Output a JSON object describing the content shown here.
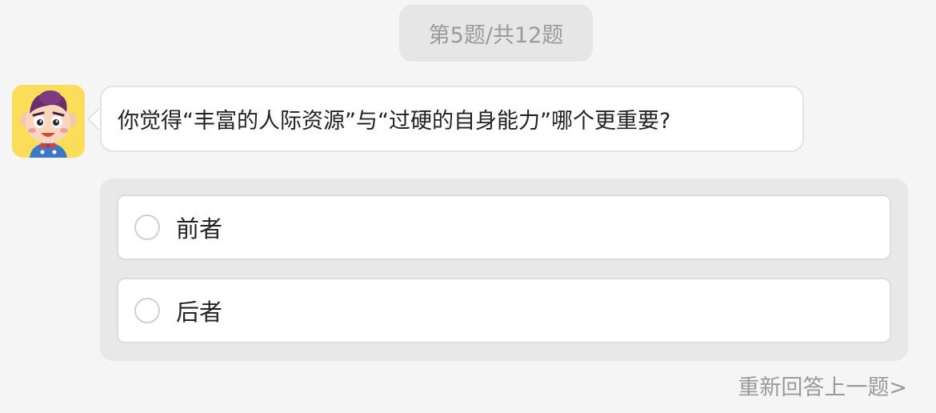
{
  "progress": {
    "text": "第5题/共12题"
  },
  "question": {
    "avatar_icon": "cartoon-boy-avatar",
    "text": "你觉得“丰富的人际资源”与“过硬的自身能力”哪个更重要?"
  },
  "options": [
    {
      "label": "前者",
      "selected": false
    },
    {
      "label": "后者",
      "selected": false
    }
  ],
  "footer": {
    "retry_label": "重新回答上一题>"
  },
  "colors": {
    "background": "#f5f5f5",
    "panel": "#e8e8e8",
    "avatar_bg": "#fcdd5a",
    "muted_text": "#9a9a9a"
  }
}
